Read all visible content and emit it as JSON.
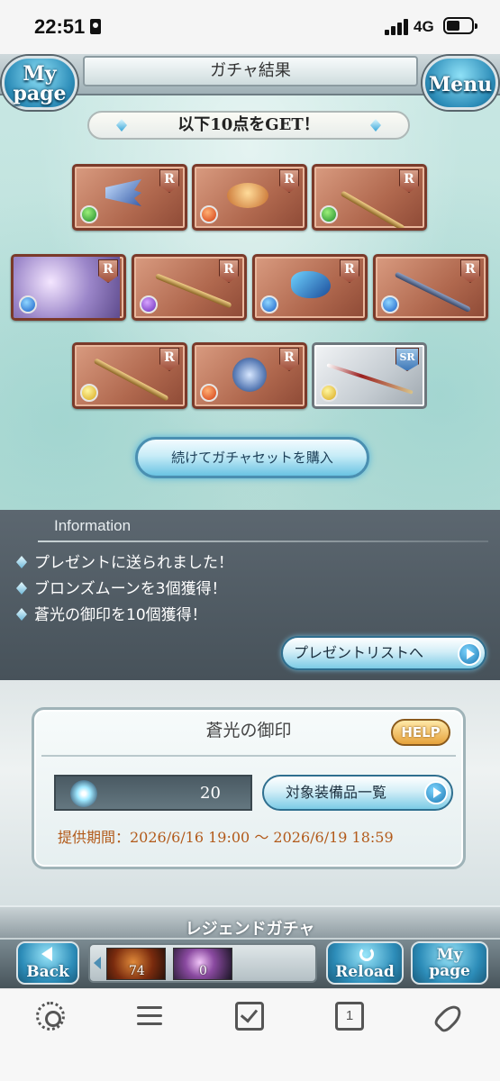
{
  "status_bar": {
    "time": "22:51",
    "network": "4G"
  },
  "header": {
    "title": "ガチャ結果",
    "left_button": "My page",
    "left_button_l1": "My",
    "left_button_l2": "page",
    "right_button": "Menu"
  },
  "result": {
    "banner": "以下10点をGET！",
    "cards": [
      {
        "rarity": "R",
        "element": "wind",
        "art": "claw"
      },
      {
        "rarity": "R",
        "element": "fire",
        "art": "bowl"
      },
      {
        "rarity": "R",
        "element": "wind",
        "art": "staff"
      },
      {
        "rarity": "R",
        "element": "water",
        "art": "character"
      },
      {
        "rarity": "R",
        "element": "dark",
        "art": "rifle"
      },
      {
        "rarity": "R",
        "element": "water",
        "art": "blade"
      },
      {
        "rarity": "R",
        "element": "water",
        "art": "staff"
      },
      {
        "rarity": "R",
        "element": "light",
        "art": "flail"
      },
      {
        "rarity": "R",
        "element": "fire",
        "art": "axe"
      },
      {
        "rarity": "SR",
        "element": "light",
        "art": "spear"
      }
    ],
    "continue_button": "続けてガチャセットを購入"
  },
  "information": {
    "heading": "Information",
    "items": [
      "プレゼントに送られました！",
      "ブロンズムーンを3個獲得！",
      "蒼光の御印を10個獲得！"
    ],
    "present_button": "プレゼントリストへ"
  },
  "seal": {
    "title": "蒼光の御印",
    "help": "HELP",
    "count": "20",
    "equip_button": "対象装備品一覧",
    "period": "提供期間：2026/6/16 19:00 〜 2026/6/19 18:59"
  },
  "legend_title": "レジェンドガチャ",
  "gamebar": {
    "back": "Back",
    "reload": "Reload",
    "mypage_l1": "My",
    "mypage_l2": "page",
    "item1_count": "74",
    "item2_count": "0"
  },
  "toolbar": {
    "tabs_count": "1"
  }
}
